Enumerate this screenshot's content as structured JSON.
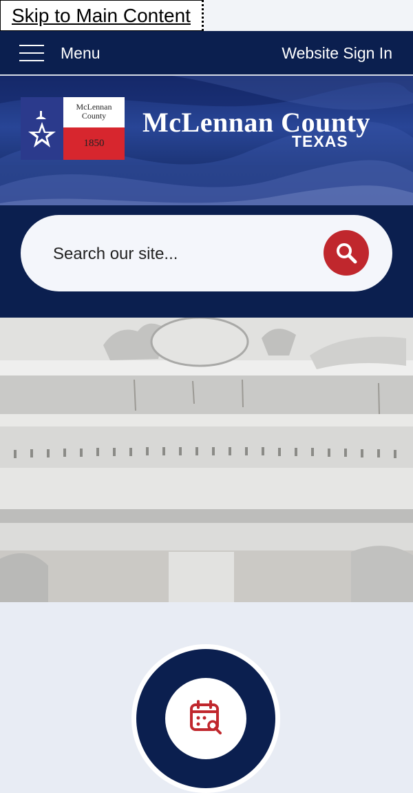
{
  "skip_link": {
    "label": "Skip to Main Content"
  },
  "topbar": {
    "menu_label": "Menu",
    "signin_label": "Website Sign In"
  },
  "logo": {
    "badge_line1": "McLennan",
    "badge_line2": "County",
    "badge_year": "1850",
    "title": "McLennan County",
    "subtitle": "TEXAS"
  },
  "search": {
    "placeholder": "Search our site..."
  },
  "icons": {
    "menu": "hamburger-icon",
    "search": "search-icon",
    "star": "star-icon",
    "calendar": "calendar-search-icon"
  },
  "colors": {
    "navy": "#0b1f4f",
    "accent_red": "#c0272d"
  }
}
